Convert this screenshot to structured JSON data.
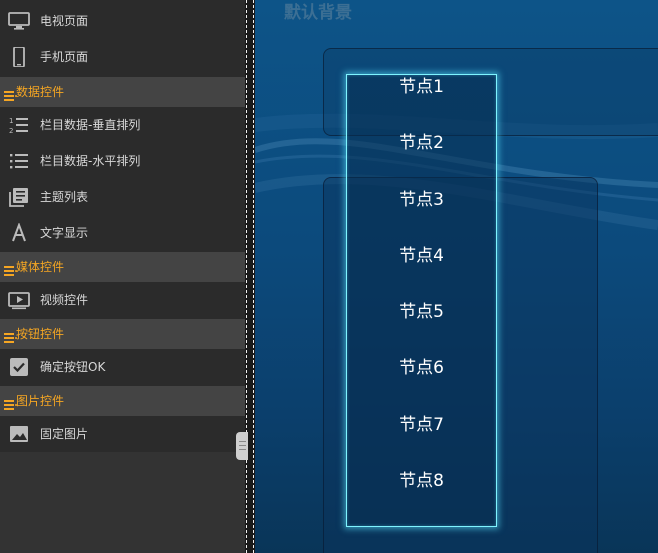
{
  "sidebar": {
    "items": [
      {
        "label": "电视页面",
        "icon": "tv-icon"
      },
      {
        "label": "手机页面",
        "icon": "phone-icon"
      },
      {
        "label": "栏目数据-垂直排列",
        "icon": "vertical-list-icon"
      },
      {
        "label": "栏目数据-水平排列",
        "icon": "horizontal-list-icon"
      },
      {
        "label": "主题列表",
        "icon": "theme-list-icon"
      },
      {
        "label": "文字显示",
        "icon": "text-icon"
      },
      {
        "label": "视频控件",
        "icon": "video-icon"
      },
      {
        "label": "确定按钮OK",
        "icon": "checkbox-icon"
      },
      {
        "label": "固定图片",
        "icon": "image-icon"
      }
    ],
    "sections": [
      {
        "label": "数据控件",
        "icon": "section-icon"
      },
      {
        "label": "媒体控件",
        "icon": "section-icon"
      },
      {
        "label": "按钮控件",
        "icon": "section-icon"
      },
      {
        "label": "图片控件",
        "icon": "section-icon"
      }
    ]
  },
  "canvas": {
    "title": "默认背景",
    "nodes": [
      "节点1",
      "节点2",
      "节点3",
      "节点4",
      "节点5",
      "节点6",
      "节点7",
      "节点8"
    ]
  },
  "colors": {
    "section_text": "#f5a623",
    "node_list_border": "#7ff4ff",
    "canvas_bg": "#0c4a7c"
  }
}
